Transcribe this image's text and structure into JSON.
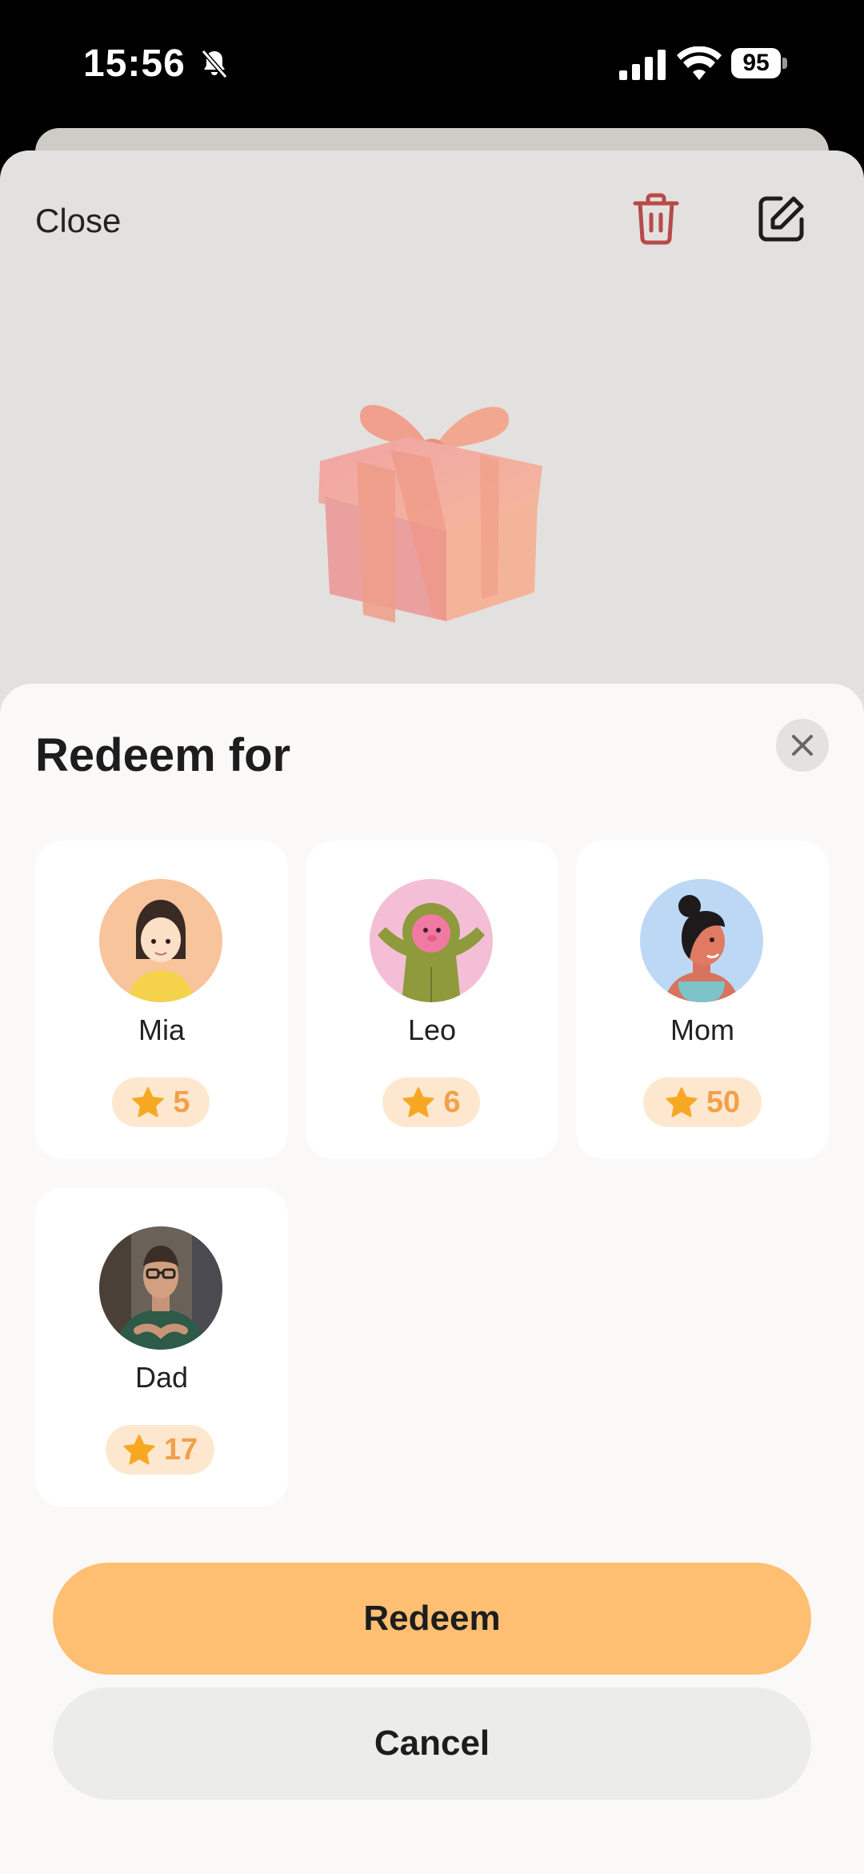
{
  "status_bar": {
    "time": "15:56",
    "battery": "95"
  },
  "top_sheet": {
    "close_label": "Close"
  },
  "sheet": {
    "title": "Redeem for"
  },
  "people": [
    {
      "name": "Mia",
      "stars": "5"
    },
    {
      "name": "Leo",
      "stars": "6"
    },
    {
      "name": "Mom",
      "stars": "50"
    },
    {
      "name": "Dad",
      "stars": "17"
    }
  ],
  "actions": {
    "redeem_label": "Redeem",
    "cancel_label": "Cancel"
  },
  "colors": {
    "accent": "#ffbf73",
    "star": "#f7a823",
    "star_text": "#f2a04a",
    "delete": "#b84a48"
  },
  "icons": [
    "bell-slash-icon",
    "signal-icon",
    "wifi-icon",
    "battery-icon",
    "trash-icon",
    "edit-icon",
    "gift-icon",
    "close-icon",
    "star-icon"
  ]
}
